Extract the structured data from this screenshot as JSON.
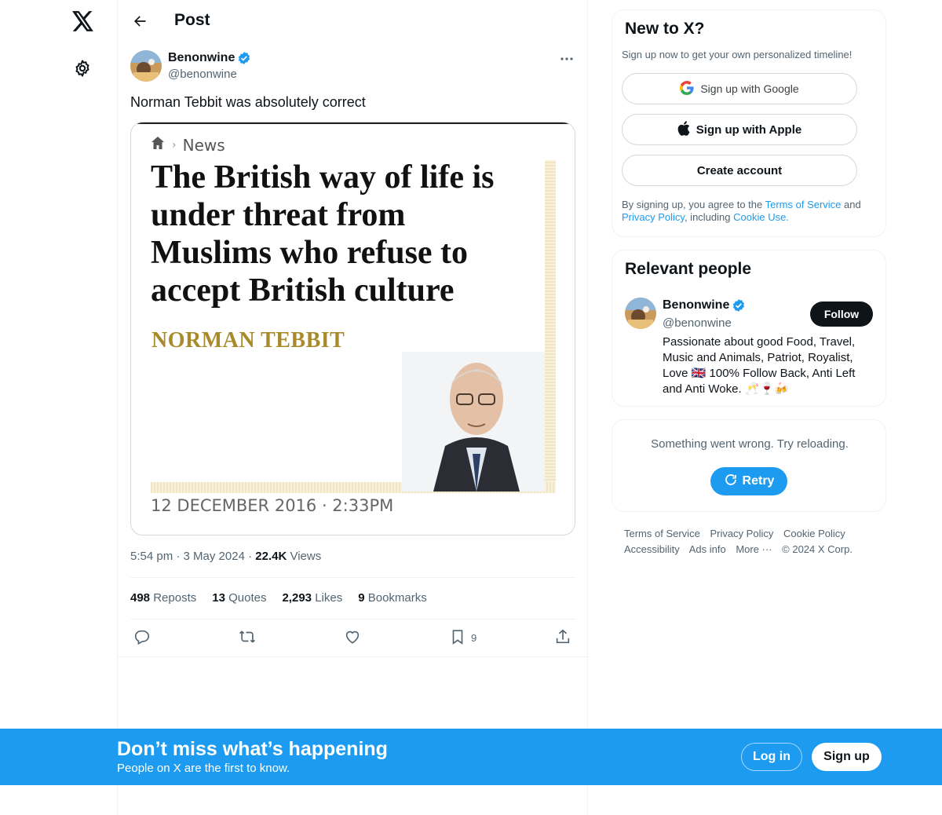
{
  "nav": {
    "logo_icon": "x-logo-icon",
    "settings_icon": "gear-icon"
  },
  "header": {
    "title": "Post"
  },
  "post": {
    "author_name": "Benonwine",
    "author_handle": "@benonwine",
    "text": "Norman Tebbit was absolutely correct",
    "media": {
      "section_label": "News",
      "headline": "The British way of life is under threat from Muslims who refuse to accept British culture",
      "byline": "NORMAN TEBBIT",
      "dateline": "12 DECEMBER 2016 · 2:33PM"
    },
    "time": "5:54 pm",
    "date": "3 May 2024",
    "views_count": "22.4K",
    "views_label": "Views",
    "stats": [
      {
        "count": "498",
        "label": "Reposts"
      },
      {
        "count": "13",
        "label": "Quotes"
      },
      {
        "count": "2,293",
        "label": "Likes"
      },
      {
        "count": "9",
        "label": "Bookmarks"
      }
    ],
    "bookmark_count": "9"
  },
  "signup_card": {
    "title": "New to X?",
    "subtitle": "Sign up now to get your own personalized timeline!",
    "google_label": "Sign up with Google",
    "apple_label": "Sign up with Apple",
    "create_label": "Create account",
    "legal_prefix": "By signing up, you agree to the ",
    "terms_link": "Terms of Service",
    "legal_and": " and ",
    "privacy_link": "Privacy Policy",
    "legal_including": ", including ",
    "cookie_link": "Cookie Use."
  },
  "relevant": {
    "title": "Relevant people",
    "name": "Benonwine",
    "handle": "@benonwine",
    "follow_label": "Follow",
    "bio": "Passionate about good Food, Travel, Music and Animals, Patriot, Royalist, Love 🇬🇧 100% Follow Back, Anti Left and Anti Woke. 🥂🍷🍻"
  },
  "error_card": {
    "message": "Something went wrong. Try reloading.",
    "retry_label": "Retry"
  },
  "footer": {
    "links": [
      "Terms of Service",
      "Privacy Policy",
      "Cookie Policy",
      "Accessibility",
      "Ads info",
      "More ···",
      "© 2024 X Corp."
    ]
  },
  "banner": {
    "title": "Don’t miss what’s happening",
    "subtitle": "People on X are the first to know.",
    "login_label": "Log in",
    "signup_label": "Sign up"
  },
  "colors": {
    "accent": "#1d9bf0",
    "text": "#0f1419",
    "muted": "#536471",
    "byline_gold": "#a88a2a"
  }
}
